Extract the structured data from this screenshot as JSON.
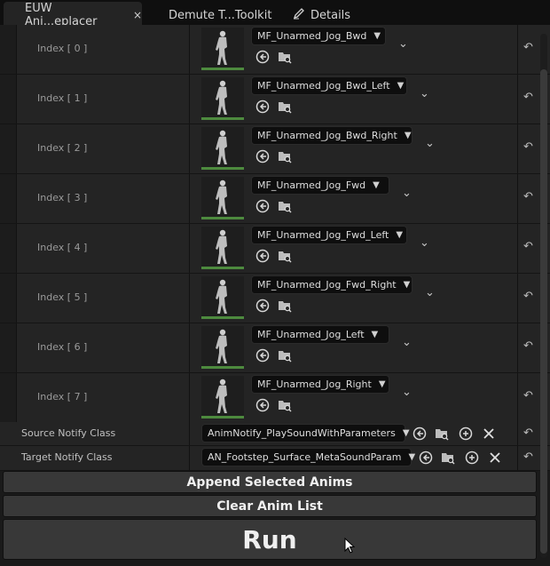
{
  "tabs": [
    {
      "label": "EUW Ani...eplacer",
      "close": "×"
    },
    {
      "label": "Demute T...Toolkit"
    },
    {
      "label": "Details"
    }
  ],
  "rows": [
    {
      "index": "Index [ 0 ]",
      "anim": "MF_Unarmed_Jog_Bwd"
    },
    {
      "index": "Index [ 1 ]",
      "anim": "MF_Unarmed_Jog_Bwd_Left"
    },
    {
      "index": "Index [ 2 ]",
      "anim": "MF_Unarmed_Jog_Bwd_Right"
    },
    {
      "index": "Index [ 3 ]",
      "anim": "MF_Unarmed_Jog_Fwd"
    },
    {
      "index": "Index [ 4 ]",
      "anim": "MF_Unarmed_Jog_Fwd_Left"
    },
    {
      "index": "Index [ 5 ]",
      "anim": "MF_Unarmed_Jog_Fwd_Right"
    },
    {
      "index": "Index [ 6 ]",
      "anim": "MF_Unarmed_Jog_Left"
    },
    {
      "index": "Index [ 7 ]",
      "anim": "MF_Unarmed_Jog_Right"
    }
  ],
  "source_notify": {
    "label": "Source Notify Class",
    "value": "AnimNotify_PlaySoundWithParameters"
  },
  "target_notify": {
    "label": "Target Notify Class",
    "value": "AN_Footstep_Surface_MetaSoundParam"
  },
  "buttons": {
    "append": "Append Selected Anims",
    "clear": "Clear Anim List",
    "run": "Run"
  },
  "icons": {
    "use": "arrow-left-circle-icon",
    "browse": "folder-search-icon",
    "add": "plus-circle-icon",
    "clear": "x-icon",
    "reset": "reset-arrow-icon",
    "details": "pencil-icon"
  }
}
